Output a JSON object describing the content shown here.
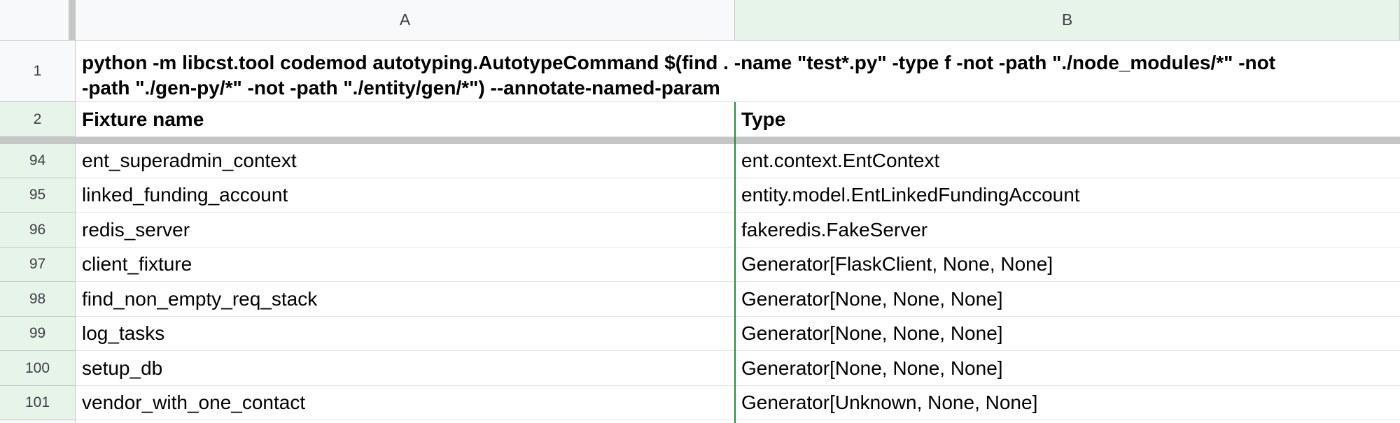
{
  "columns": [
    {
      "label": "A"
    },
    {
      "label": "B"
    }
  ],
  "header_rows": [
    {
      "num": "1",
      "command_line1": "python -m libcst.tool codemod autotyping.AutotypeCommand $(find . -name \"test*.py\" -type f -not -path \"./node_modules/*\" -not",
      "command_line2": "-path \"./gen-py/*\" -not -path \"./entity/gen/*\")  --annotate-named-param"
    },
    {
      "num": "2",
      "a": "Fixture name",
      "b": "Type"
    }
  ],
  "rows": [
    {
      "num": "94",
      "a": "ent_superadmin_context",
      "b": "ent.context.EntContext"
    },
    {
      "num": "95",
      "a": "linked_funding_account",
      "b": "entity.model.EntLinkedFundingAccount"
    },
    {
      "num": "96",
      "a": "redis_server",
      "b": "fakeredis.FakeServer"
    },
    {
      "num": "97",
      "a": "client_fixture",
      "b": "Generator[FlaskClient, None, None]"
    },
    {
      "num": "98",
      "a": "find_non_empty_req_stack",
      "b": "Generator[None, None, None]"
    },
    {
      "num": "99",
      "a": "log_tasks",
      "b": "Generator[None, None, None]"
    },
    {
      "num": "100",
      "a": "setup_db",
      "b": "Generator[None, None, None]"
    },
    {
      "num": "101",
      "a": "vendor_with_one_contact",
      "b": "Generator[Unknown, None, None]"
    }
  ]
}
